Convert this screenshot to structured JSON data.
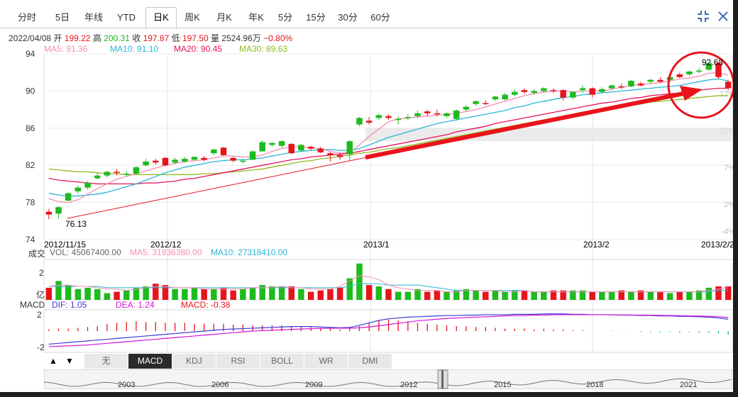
{
  "tabs": [
    {
      "label": "分时"
    },
    {
      "label": "5日"
    },
    {
      "label": "年线"
    },
    {
      "label": "YTD"
    },
    {
      "label": "日K",
      "active": true
    },
    {
      "label": "周K"
    },
    {
      "label": "月K"
    },
    {
      "label": "年K"
    },
    {
      "label": "5分"
    },
    {
      "label": "15分"
    },
    {
      "label": "30分"
    },
    {
      "label": "60分"
    }
  ],
  "info": {
    "date": "2022/04/08",
    "open_label": "开",
    "open": "199.22",
    "high_label": "高",
    "high": "200.31",
    "close_label": "收",
    "close": "197.87",
    "low_label": "低",
    "low": "197.50",
    "vol_label": "量",
    "vol": "2524.96万",
    "change": "−0.80%"
  },
  "ma": {
    "ma5": "MA5: 91.36",
    "ma10": "MA10: 91.10",
    "ma20": "MA20: 90.45",
    "ma30": "MA30: 89.63"
  },
  "volume_info": {
    "label": "成交",
    "vol": "VOL: 45067400.00",
    "ma5": "MA5: 31936380.00",
    "ma10": "MA10: 27318410.00",
    "unit": "亿"
  },
  "macd_info": {
    "label": "MACD",
    "dif": "DIF: 1.05",
    "dea": "DEA: 1.24",
    "macd": "MACD: -0.38"
  },
  "indicator_buttons": [
    "无",
    "MACD",
    "KDJ",
    "RSI",
    "BOLL",
    "WR",
    "DMI"
  ],
  "indicator_active": "MACD",
  "history_years": [
    "2003",
    "2006",
    "2009",
    "2012",
    "2015",
    "2018",
    "2021"
  ],
  "colors": {
    "up": "#e8141b",
    "down": "#1dbb1d",
    "ma5": "#f48fb1",
    "ma10": "#29b6d6",
    "ma20": "#e8135a",
    "ma30": "#8fbc1a",
    "arrow": "#e8141b",
    "dif": "#3b3bd9",
    "dea": "#d414d4"
  },
  "icons": [
    "compress-icon",
    "close-icon",
    "up-arrow-icon",
    "down-arrow-icon",
    "slider-handle-icon"
  ],
  "chart_data": [
    {
      "type": "candlestick",
      "yticks": [
        74,
        78,
        82,
        86,
        90,
        94
      ],
      "ylim": [
        74,
        94
      ],
      "right_ticks": [
        "17%",
        "12%",
        "7%",
        "2%",
        "-4%"
      ],
      "xticks": [
        "2012/11/15",
        "2012/12",
        "2013/1",
        "2013/2",
        "2013/2/2"
      ],
      "annotations": {
        "low": "76.13",
        "high": "92.68"
      },
      "candles": [
        {
          "o": 77.0,
          "c": 76.7,
          "h": 77.3,
          "l": 76.2
        },
        {
          "o": 76.8,
          "c": 77.5,
          "h": 77.6,
          "l": 76.3
        },
        {
          "o": 78.2,
          "c": 79.0,
          "h": 79.1,
          "l": 78.1
        },
        {
          "o": 79.2,
          "c": 79.6,
          "h": 79.8,
          "l": 79.0
        },
        {
          "o": 79.6,
          "c": 80.1,
          "h": 80.3,
          "l": 79.4
        },
        {
          "o": 80.6,
          "c": 80.9,
          "h": 81.2,
          "l": 80.5
        },
        {
          "o": 80.9,
          "c": 81.3,
          "h": 81.4,
          "l": 80.7
        },
        {
          "o": 81.3,
          "c": 81.2,
          "h": 81.6,
          "l": 80.9
        },
        {
          "o": 81.0,
          "c": 81.1,
          "h": 81.4,
          "l": 80.8
        },
        {
          "o": 81.1,
          "c": 81.8,
          "h": 81.9,
          "l": 81.0
        },
        {
          "o": 82.0,
          "c": 82.4,
          "h": 82.7,
          "l": 81.9
        },
        {
          "o": 82.5,
          "c": 82.3,
          "h": 82.7,
          "l": 82.1
        },
        {
          "o": 82.8,
          "c": 82.0,
          "h": 82.9,
          "l": 81.9
        },
        {
          "o": 82.3,
          "c": 82.6,
          "h": 82.8,
          "l": 82.1
        },
        {
          "o": 82.4,
          "c": 82.7,
          "h": 82.9,
          "l": 82.3
        },
        {
          "o": 82.6,
          "c": 82.9,
          "h": 83.0,
          "l": 82.5
        },
        {
          "o": 82.8,
          "c": 82.6,
          "h": 83.0,
          "l": 82.4
        },
        {
          "o": 83.3,
          "c": 83.7,
          "h": 83.8,
          "l": 83.1
        },
        {
          "o": 83.9,
          "c": 83.1,
          "h": 84.0,
          "l": 83.0
        },
        {
          "o": 82.8,
          "c": 82.5,
          "h": 82.9,
          "l": 82.3
        },
        {
          "o": 82.4,
          "c": 82.5,
          "h": 82.7,
          "l": 82.2
        },
        {
          "o": 82.6,
          "c": 83.5,
          "h": 83.6,
          "l": 82.6
        },
        {
          "o": 83.5,
          "c": 84.5,
          "h": 84.7,
          "l": 83.5
        },
        {
          "o": 84.2,
          "c": 84.4,
          "h": 84.5,
          "l": 84.0
        },
        {
          "o": 84.1,
          "c": 84.6,
          "h": 84.7,
          "l": 83.9
        },
        {
          "o": 84.3,
          "c": 83.3,
          "h": 84.4,
          "l": 83.2
        },
        {
          "o": 83.6,
          "c": 84.2,
          "h": 84.3,
          "l": 83.5
        },
        {
          "o": 84.0,
          "c": 83.8,
          "h": 84.1,
          "l": 83.6
        },
        {
          "o": 83.8,
          "c": 83.4,
          "h": 84.0,
          "l": 83.3
        },
        {
          "o": 83.3,
          "c": 83.1,
          "h": 83.5,
          "l": 82.4
        },
        {
          "o": 83.1,
          "c": 82.9,
          "h": 83.4,
          "l": 82.6
        },
        {
          "o": 83.2,
          "c": 84.6,
          "h": 84.7,
          "l": 82.5
        },
        {
          "o": 86.4,
          "c": 87.1,
          "h": 87.2,
          "l": 86.2
        },
        {
          "o": 86.8,
          "c": 86.6,
          "h": 87.2,
          "l": 86.4
        },
        {
          "o": 87.1,
          "c": 87.4,
          "h": 87.6,
          "l": 86.9
        },
        {
          "o": 87.3,
          "c": 87.1,
          "h": 87.5,
          "l": 86.9
        },
        {
          "o": 86.9,
          "c": 87.0,
          "h": 87.3,
          "l": 86.4
        },
        {
          "o": 87.1,
          "c": 87.2,
          "h": 87.5,
          "l": 86.9
        },
        {
          "o": 87.3,
          "c": 87.6,
          "h": 87.9,
          "l": 87.1
        },
        {
          "o": 87.8,
          "c": 87.6,
          "h": 88.0,
          "l": 87.3
        },
        {
          "o": 87.6,
          "c": 87.5,
          "h": 88.0,
          "l": 87.3
        },
        {
          "o": 87.3,
          "c": 87.6,
          "h": 87.7,
          "l": 87.1
        },
        {
          "o": 87.0,
          "c": 87.9,
          "h": 88.0,
          "l": 86.8
        },
        {
          "o": 88.0,
          "c": 88.3,
          "h": 88.5,
          "l": 87.8
        },
        {
          "o": 88.6,
          "c": 88.9,
          "h": 89.0,
          "l": 88.4
        },
        {
          "o": 88.7,
          "c": 88.6,
          "h": 89.0,
          "l": 88.5
        },
        {
          "o": 89.1,
          "c": 89.4,
          "h": 89.5,
          "l": 88.9
        },
        {
          "o": 89.1,
          "c": 89.6,
          "h": 89.8,
          "l": 89.0
        },
        {
          "o": 89.6,
          "c": 89.9,
          "h": 90.2,
          "l": 89.4
        },
        {
          "o": 90.1,
          "c": 89.9,
          "h": 90.3,
          "l": 89.7
        },
        {
          "o": 89.8,
          "c": 90.0,
          "h": 90.2,
          "l": 89.6
        },
        {
          "o": 90.0,
          "c": 90.3,
          "h": 90.4,
          "l": 89.8
        },
        {
          "o": 90.1,
          "c": 90.0,
          "h": 90.3,
          "l": 89.8
        },
        {
          "o": 90.1,
          "c": 89.3,
          "h": 90.2,
          "l": 89.0
        },
        {
          "o": 89.3,
          "c": 89.9,
          "h": 90.0,
          "l": 89.1
        },
        {
          "o": 90.1,
          "c": 90.3,
          "h": 90.6,
          "l": 89.8
        },
        {
          "o": 90.3,
          "c": 89.6,
          "h": 90.4,
          "l": 89.3
        },
        {
          "o": 89.9,
          "c": 90.2,
          "h": 90.4,
          "l": 89.8
        },
        {
          "o": 90.3,
          "c": 90.6,
          "h": 90.7,
          "l": 90.1
        },
        {
          "o": 90.5,
          "c": 90.4,
          "h": 90.8,
          "l": 90.2
        },
        {
          "o": 90.5,
          "c": 91.1,
          "h": 91.2,
          "l": 90.4
        },
        {
          "o": 90.8,
          "c": 90.6,
          "h": 91.0,
          "l": 90.5
        },
        {
          "o": 91.0,
          "c": 91.2,
          "h": 91.3,
          "l": 90.8
        },
        {
          "o": 91.2,
          "c": 91.0,
          "h": 91.5,
          "l": 90.9
        },
        {
          "o": 91.2,
          "c": 91.5,
          "h": 91.6,
          "l": 91.0
        },
        {
          "o": 91.8,
          "c": 91.5,
          "h": 92.0,
          "l": 91.4
        },
        {
          "o": 91.8,
          "c": 92.1,
          "h": 92.2,
          "l": 91.6
        },
        {
          "o": 92.2,
          "c": 92.2,
          "h": 92.5,
          "l": 91.9
        },
        {
          "o": 92.3,
          "c": 93.0,
          "h": 93.1,
          "l": 92.2
        },
        {
          "o": 93.0,
          "c": 91.5,
          "h": 93.1,
          "l": 91.3
        },
        {
          "o": 91.0,
          "c": 90.3,
          "h": 91.2,
          "l": 90.1
        }
      ],
      "ma5": [
        78.4,
        78.1,
        78.0,
        78.3,
        78.9,
        79.5,
        80.0,
        80.5,
        80.8,
        81.1,
        81.4,
        81.7,
        82.0,
        82.2,
        82.4,
        82.5,
        82.6,
        82.8,
        83.0,
        83.0,
        82.9,
        82.9,
        83.1,
        83.5,
        83.8,
        84.0,
        84.0,
        83.9,
        83.8,
        83.5,
        83.3,
        83.4,
        84.2,
        85.1,
        85.9,
        86.7,
        87.0,
        87.1,
        87.2,
        87.3,
        87.4,
        87.5,
        87.6,
        87.8,
        88.0,
        88.3,
        88.6,
        88.9,
        89.2,
        89.5,
        89.7,
        89.9,
        90.0,
        90.0,
        89.9,
        90.0,
        90.0,
        90.0,
        90.2,
        90.4,
        90.6,
        90.7,
        90.8,
        90.9,
        91.1,
        91.3,
        91.4,
        91.6,
        91.9,
        92.0,
        91.7
      ],
      "ma10": [
        79.0,
        78.8,
        78.7,
        78.7,
        78.8,
        78.9,
        79.1,
        79.4,
        79.7,
        80.0,
        80.4,
        80.8,
        81.2,
        81.5,
        81.8,
        82.0,
        82.2,
        82.4,
        82.5,
        82.6,
        82.6,
        82.7,
        82.8,
        83.0,
        83.2,
        83.4,
        83.5,
        83.6,
        83.7,
        83.7,
        83.6,
        83.6,
        83.8,
        84.2,
        84.6,
        85.0,
        85.3,
        85.6,
        85.9,
        86.2,
        86.5,
        86.7,
        86.9,
        87.1,
        87.3,
        87.5,
        87.7,
        87.9,
        88.2,
        88.4,
        88.7,
        88.9,
        89.1,
        89.3,
        89.4,
        89.6,
        89.7,
        89.8,
        89.9,
        90.0,
        90.1,
        90.2,
        90.3,
        90.4,
        90.5,
        90.6,
        90.8,
        91.0,
        91.2,
        91.3,
        91.1
      ],
      "ma20": [
        80.6,
        80.4,
        80.3,
        80.2,
        80.1,
        80.0,
        80.0,
        80.0,
        80.0,
        80.0,
        80.1,
        80.1,
        80.2,
        80.3,
        80.5,
        80.6,
        80.8,
        81.0,
        81.2,
        81.4,
        81.6,
        81.8,
        82.0,
        82.2,
        82.4,
        82.6,
        82.7,
        82.9,
        83.0,
        83.1,
        83.2,
        83.3,
        83.5,
        83.7,
        83.9,
        84.1,
        84.3,
        84.5,
        84.7,
        84.9,
        85.1,
        85.3,
        85.6,
        85.8,
        86.0,
        86.2,
        86.5,
        86.7,
        86.9,
        87.1,
        87.3,
        87.5,
        87.7,
        87.9,
        88.1,
        88.3,
        88.5,
        88.7,
        88.8,
        89.0,
        89.2,
        89.3,
        89.5,
        89.6,
        89.7,
        89.8,
        90.0,
        90.1,
        90.2,
        90.3,
        90.3
      ],
      "ma30": [
        81.6,
        81.5,
        81.4,
        81.3,
        81.3,
        81.2,
        81.1,
        81.1,
        81.0,
        81.0,
        81.0,
        81.0,
        81.0,
        81.0,
        81.0,
        81.0,
        81.1,
        81.1,
        81.2,
        81.3,
        81.4,
        81.5,
        81.6,
        81.8,
        82.0,
        82.2,
        82.4,
        82.5,
        82.7,
        82.8,
        83.0,
        83.1,
        83.3,
        83.4,
        83.6,
        83.8,
        83.9,
        84.1,
        84.3,
        84.5,
        84.7,
        84.9,
        85.1,
        85.3,
        85.5,
        85.7,
        85.9,
        86.1,
        86.3,
        86.5,
        86.7,
        86.9,
        87.1,
        87.3,
        87.5,
        87.7,
        87.9,
        88.0,
        88.2,
        88.3,
        88.5,
        88.6,
        88.8,
        88.9,
        89.0,
        89.1,
        89.2,
        89.3,
        89.4,
        89.5,
        89.5
      ]
    },
    {
      "type": "bar",
      "name": "volume",
      "yticks": [
        "2"
      ],
      "values": [
        0.9,
        1.4,
        1.1,
        0.8,
        0.9,
        0.8,
        0.5,
        0.6,
        0.7,
        0.9,
        1.0,
        1.2,
        1.1,
        0.8,
        0.8,
        0.9,
        0.8,
        0.8,
        0.9,
        0.7,
        0.8,
        0.9,
        1.1,
        1.0,
        1.0,
        1.0,
        0.8,
        0.6,
        0.7,
        0.8,
        0.9,
        1.6,
        2.7,
        1.1,
        1.0,
        0.8,
        0.6,
        0.6,
        0.8,
        0.6,
        0.7,
        0.6,
        0.7,
        0.8,
        0.7,
        0.6,
        0.7,
        0.6,
        0.7,
        0.7,
        0.6,
        0.6,
        0.7,
        0.7,
        0.7,
        0.7,
        0.6,
        0.6,
        0.6,
        0.7,
        0.6,
        0.7,
        0.6,
        0.6,
        0.5,
        0.6,
        0.6,
        0.7,
        0.9,
        1.0,
        1.0
      ],
      "ma5": [
        1.0,
        1.1,
        1.1,
        1.0,
        1.0,
        0.9,
        0.8,
        0.8,
        0.7,
        0.8,
        0.9,
        1.0,
        1.0,
        0.9,
        0.9,
        0.9,
        0.8,
        0.8,
        0.8,
        0.8,
        0.8,
        0.9,
        0.9,
        0.9,
        1.0,
        0.9,
        0.9,
        0.8,
        0.8,
        0.8,
        1.0,
        1.4,
        1.8,
        1.7,
        1.5,
        1.1,
        0.9,
        0.8,
        0.7,
        0.7,
        0.7,
        0.6,
        0.6,
        0.7,
        0.7,
        0.7,
        0.7,
        0.6,
        0.6,
        0.7,
        0.6,
        0.6,
        0.6,
        0.6,
        0.6,
        0.6,
        0.6,
        0.6,
        0.6,
        0.6,
        0.6,
        0.6,
        0.6,
        0.6,
        0.6,
        0.6,
        0.6,
        0.6,
        0.7,
        0.8,
        0.9
      ],
      "ma10": [
        1.0,
        1.0,
        1.0,
        1.0,
        1.0,
        1.0,
        0.9,
        0.9,
        0.9,
        0.9,
        0.9,
        0.9,
        0.9,
        0.9,
        0.9,
        0.9,
        0.9,
        0.9,
        0.9,
        0.9,
        0.9,
        0.9,
        0.9,
        0.9,
        0.9,
        0.9,
        0.9,
        0.9,
        0.9,
        0.9,
        0.9,
        1.0,
        1.2,
        1.2,
        1.2,
        1.1,
        1.1,
        1.1,
        1.1,
        1.0,
        0.9,
        0.8,
        0.7,
        0.7,
        0.7,
        0.7,
        0.7,
        0.7,
        0.7,
        0.7,
        0.6,
        0.6,
        0.6,
        0.6,
        0.6,
        0.6,
        0.6,
        0.6,
        0.6,
        0.6,
        0.6,
        0.6,
        0.6,
        0.6,
        0.6,
        0.6,
        0.6,
        0.6,
        0.6,
        0.7,
        0.7
      ]
    },
    {
      "type": "macd",
      "yticks": [
        "2",
        "-2"
      ],
      "ylim": [
        -2.6,
        2.6
      ],
      "dif": [
        -1.6,
        -1.5,
        -1.4,
        -1.3,
        -1.2,
        -1.1,
        -1.0,
        -0.9,
        -0.8,
        -0.7,
        -0.6,
        -0.5,
        -0.4,
        -0.3,
        -0.2,
        -0.1,
        0.0,
        0.1,
        0.2,
        0.25,
        0.3,
        0.35,
        0.4,
        0.45,
        0.5,
        0.55,
        0.55,
        0.55,
        0.5,
        0.45,
        0.4,
        0.45,
        0.7,
        1.0,
        1.3,
        1.5,
        1.6,
        1.7,
        1.75,
        1.8,
        1.85,
        1.9,
        1.9,
        1.95,
        1.95,
        2.0,
        2.0,
        2.0,
        2.05,
        2.05,
        2.05,
        2.1,
        2.1,
        2.1,
        2.05,
        2.05,
        2.0,
        2.0,
        2.0,
        1.95,
        1.95,
        1.9,
        1.9,
        1.85,
        1.85,
        1.8,
        1.8,
        1.75,
        1.7,
        1.6,
        1.45
      ],
      "dea": [
        -1.9,
        -1.85,
        -1.8,
        -1.75,
        -1.7,
        -1.6,
        -1.5,
        -1.4,
        -1.3,
        -1.2,
        -1.1,
        -1.0,
        -0.9,
        -0.8,
        -0.7,
        -0.6,
        -0.5,
        -0.4,
        -0.3,
        -0.2,
        -0.1,
        0.0,
        0.05,
        0.1,
        0.15,
        0.2,
        0.25,
        0.3,
        0.32,
        0.34,
        0.35,
        0.36,
        0.4,
        0.5,
        0.65,
        0.8,
        0.95,
        1.1,
        1.25,
        1.35,
        1.45,
        1.55,
        1.6,
        1.65,
        1.7,
        1.75,
        1.8,
        1.85,
        1.9,
        1.9,
        1.95,
        1.95,
        2.0,
        2.0,
        2.0,
        2.0,
        2.0,
        2.0,
        1.98,
        1.97,
        1.96,
        1.95,
        1.94,
        1.92,
        1.9,
        1.88,
        1.86,
        1.84,
        1.8,
        1.75,
        1.68
      ],
      "bars": [
        0.2,
        0.3,
        0.3,
        0.4,
        0.5,
        0.6,
        0.9,
        1.0,
        1.1,
        1.2,
        1.1,
        1.1,
        1.0,
        1.0,
        1.0,
        0.9,
        0.9,
        0.9,
        0.9,
        0.8,
        0.8,
        0.7,
        0.7,
        0.7,
        0.7,
        0.6,
        0.6,
        0.5,
        0.4,
        0.3,
        0.2,
        0.3,
        0.6,
        1.0,
        1.3,
        1.4,
        1.3,
        1.2,
        1.0,
        0.9,
        0.8,
        0.7,
        0.6,
        0.6,
        0.5,
        0.5,
        0.4,
        0.3,
        0.3,
        0.3,
        0.2,
        0.3,
        0.2,
        0.2,
        0.1,
        0.1,
        0.0,
        0.0,
        0.04,
        -0.04,
        -0.02,
        -0.1,
        -0.08,
        -0.14,
        -0.1,
        -0.16,
        -0.12,
        -0.18,
        -0.2,
        -0.3,
        -0.46
      ]
    }
  ]
}
